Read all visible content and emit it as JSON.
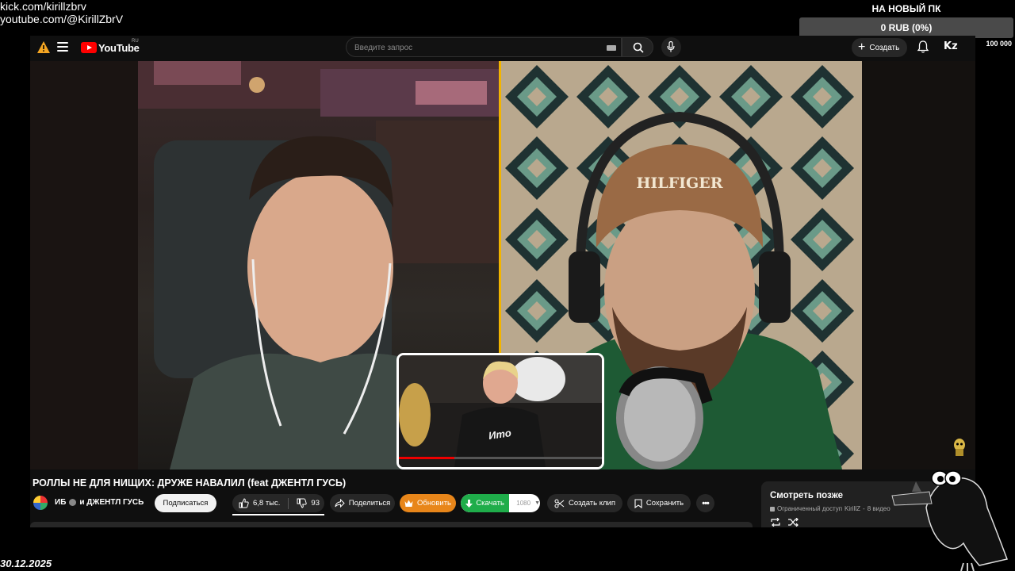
{
  "overlay": {
    "links": [
      "kick.com/kirillzbrv",
      "youtube.com/@KirillZbrV"
    ],
    "date": "30.12.2025"
  },
  "goal": {
    "title": "НА НОВЫЙ ПК",
    "bar_text": "0 RUB (0%)",
    "progress": 0,
    "min": "0",
    "max": "100 000"
  },
  "header": {
    "logo_text": "YouTube",
    "region": "RU",
    "search_placeholder": "Введите запрос",
    "create_label": "Создать",
    "avatar_text": "Kz"
  },
  "video": {
    "title": "РОЛЛЫ НЕ ДЛЯ НИЩИХ: ДРУЖЕ НАВАЛИЛ (feat ДЖЕНТЛ ГУСЬ)",
    "channel_primary": "ИБ",
    "channel_secondary": "и ДЖЕНТЛ ГУСЬ",
    "cap_brand": "HILFIGER"
  },
  "actions": {
    "subscribe": "Подписаться",
    "likes": "6,8 тыс.",
    "dislikes": "93",
    "share": "Поделиться",
    "update": "Обновить",
    "download": "Скачать",
    "quality": "1080",
    "clip": "Создать клип",
    "save": "Сохранить"
  },
  "watch_later": {
    "title": "Смотреть позже",
    "access": "Ограниченный доступ",
    "owner": "KirillZ",
    "count": "8 видео"
  },
  "colors": {
    "accent_divider": "#f2b400",
    "youtube_red": "#ff0000",
    "update_orange": "#e8861a",
    "download_green": "#1fad4a"
  }
}
